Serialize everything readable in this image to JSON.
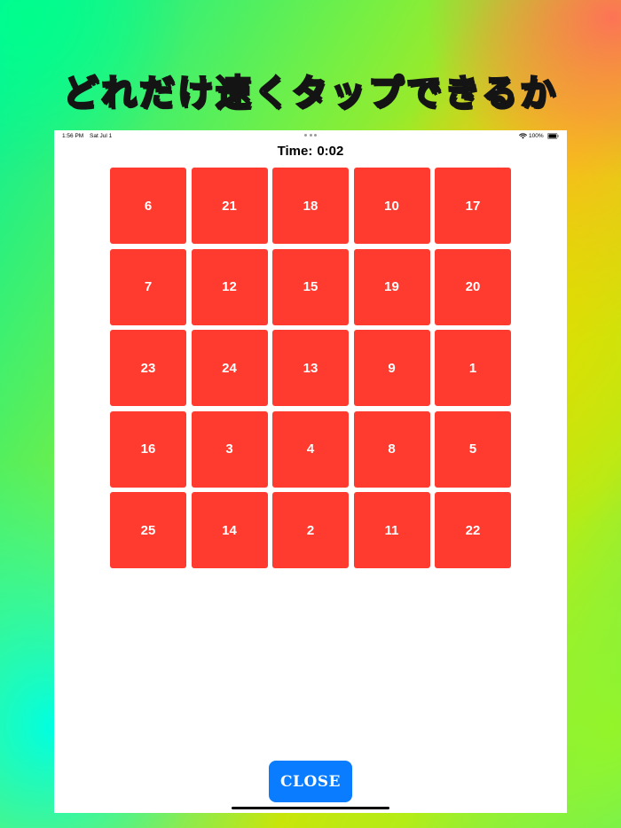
{
  "banner": {
    "title": "どれだけ速くタップできるか"
  },
  "status_bar": {
    "time": "1:56 PM",
    "date": "Sat Jul 1",
    "battery": "100%",
    "icons": [
      "wifi-icon",
      "battery-icon"
    ]
  },
  "game": {
    "timer_label": "Time:",
    "timer_value": "0:02",
    "tiles": [
      "6",
      "21",
      "18",
      "10",
      "17",
      "7",
      "12",
      "15",
      "19",
      "20",
      "23",
      "24",
      "13",
      "9",
      "1",
      "16",
      "3",
      "4",
      "8",
      "5",
      "25",
      "14",
      "2",
      "11",
      "22"
    ],
    "close_label": "CLOSE"
  },
  "colors": {
    "tile": "#ff3b30",
    "close_button": "#0a7cff",
    "screen_background": "#ffffff"
  }
}
